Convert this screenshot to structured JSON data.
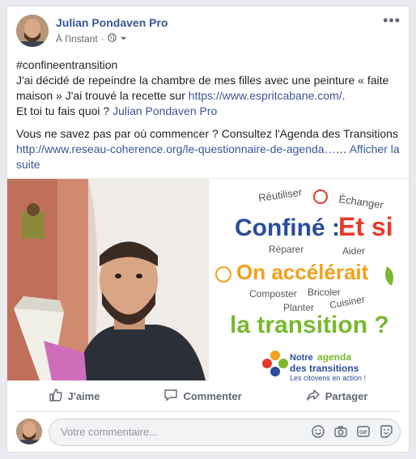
{
  "post": {
    "author": "Julian Pondaven Pro",
    "time": "À l'instant",
    "separator": "·",
    "hashtag": "#confineentransition",
    "line1_prefix": "J'ai décidé de repeindre la chambre de mes filles avec une peinture « faite maison » J'ai trouvé la recette sur ",
    "link1": "https://www.espritcabane.com/",
    "link1_suffix": ".",
    "line2_prefix": "Et toi tu fais quoi ? ",
    "mention": "Julian Pondaven Pro",
    "para2_prefix": "Vous ne savez pas par où commencer ? Consultez l'Agenda des Transitions ",
    "link2": "http://www.reseau-coherence.org/le-questionnaire-de-agenda…",
    "ellipsis": "… ",
    "see_more": "Afficher la suite"
  },
  "poster": {
    "reutiliser": "Réutiliser",
    "echanger": "Échanger",
    "confine": "Confiné :",
    "et_si": "Et si",
    "reparer": "Réparer",
    "aider": "Aider",
    "on_accelerait": "On accélérait",
    "composter": "Composter",
    "bricoler": "Bricoler",
    "planter": "Planter",
    "cuisiner": "Cuisiner",
    "la_transition": "la transition ?",
    "notre": "Notre",
    "agenda": "agenda",
    "des_transitions": "des transitions",
    "citoyens": "Les citoyens en action !"
  },
  "actions": {
    "like": "J'aime",
    "comment": "Commenter",
    "share": "Partager"
  },
  "comment_box": {
    "placeholder": "Votre commentaire..."
  },
  "colors": {
    "link": "#385898",
    "poster_blue": "#2a4d9b",
    "poster_red": "#e53a2a",
    "poster_green": "#7ab82f",
    "poster_orange": "#f2a01c"
  }
}
